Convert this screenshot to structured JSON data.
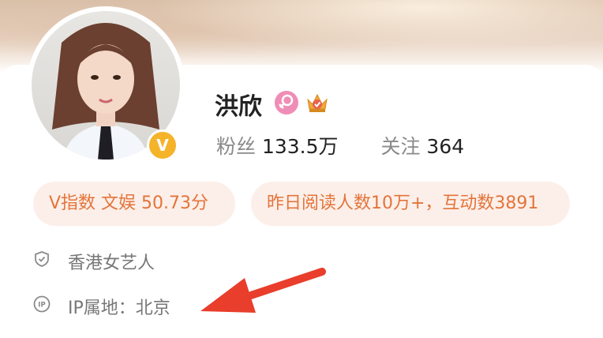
{
  "profile": {
    "name": "洪欣",
    "verified_mark": "V",
    "icons": [
      "female-icon",
      "crown-level-icon"
    ],
    "stats": {
      "fans_label": "粉丝",
      "fans_value": "133.5万",
      "following_label": "关注",
      "following_value": "364"
    }
  },
  "tags": {
    "v_index": "V指数 文娱 50.73分",
    "reads": "昨日阅读人数10万+，互动数3891"
  },
  "info": {
    "description": "香港女艺人",
    "ip_location": "IP属地：北京"
  },
  "colors": {
    "accent_orange": "#e4743a",
    "pill_bg": "#fcefe9",
    "verify_gold": "#f5b32a",
    "female_pink": "#f08db6",
    "arrow_red": "#e83e2b"
  }
}
